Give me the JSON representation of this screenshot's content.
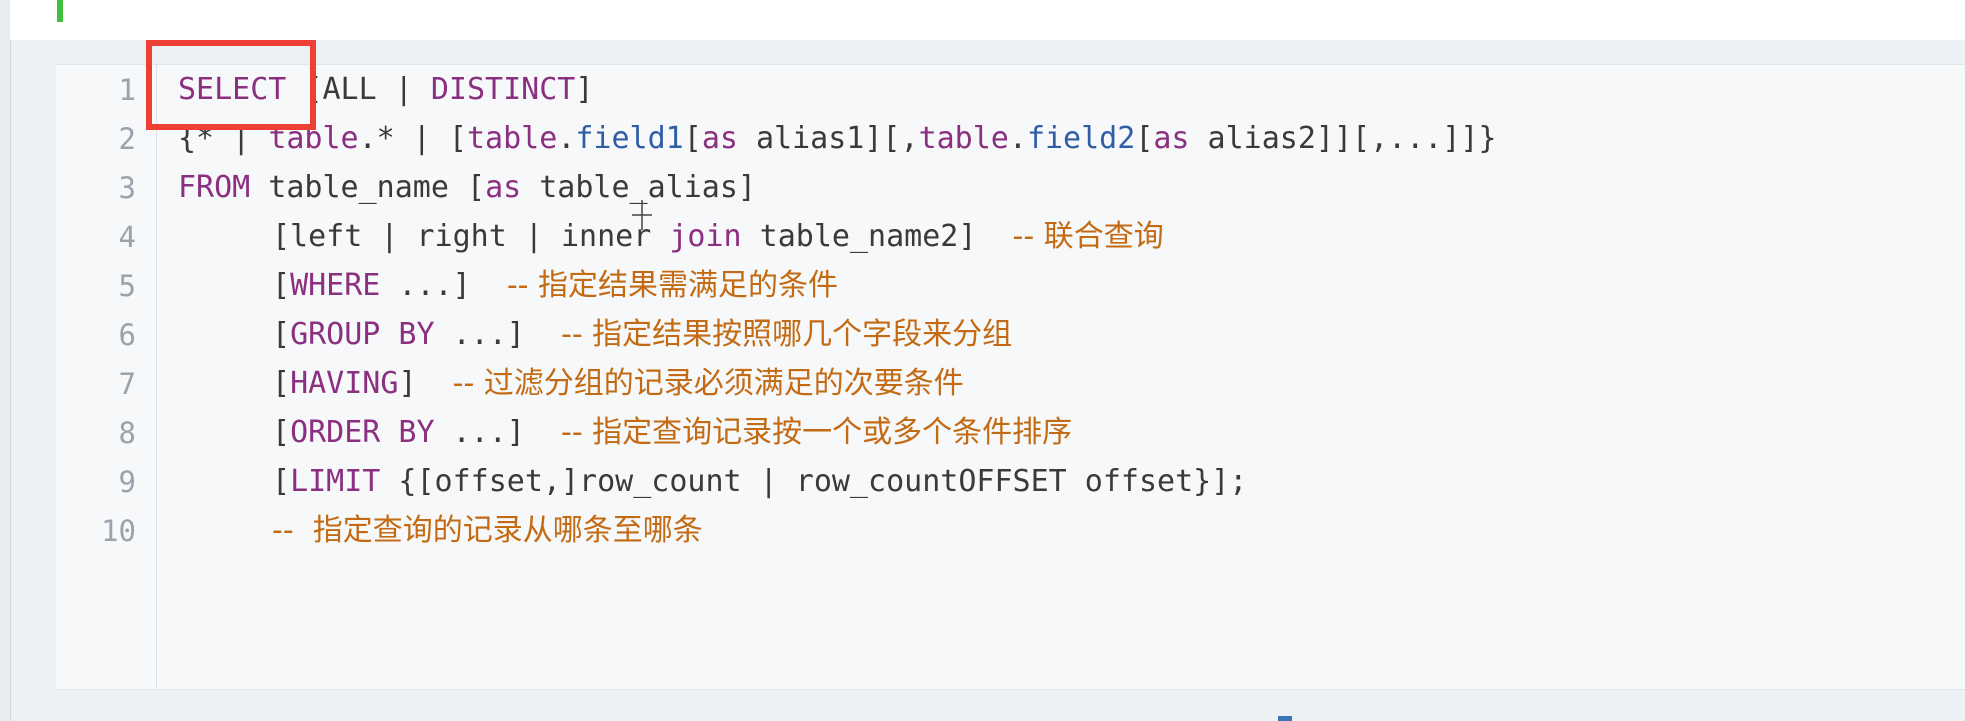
{
  "code": {
    "lines": [
      {
        "number": "1",
        "parts": [
          "SELECT",
          " [ALL | ",
          "DISTINCT",
          "]"
        ]
      },
      {
        "number": "2",
        "parts": [
          "{* | ",
          "table",
          ".* | [",
          "table",
          ".",
          "field1",
          "[",
          "as",
          " alias1][,",
          "table",
          ".",
          "field2",
          "[",
          "as",
          " alias2]][,...]]}"
        ]
      },
      {
        "number": "3",
        "parts": [
          "FROM",
          " table_name [",
          "as",
          " table_alias]"
        ]
      },
      {
        "number": "4",
        "parts": [
          "[left | right | inner ",
          "join",
          " table_name2]  ",
          "-- 联合查询"
        ]
      },
      {
        "number": "5",
        "parts": [
          "[",
          "WHERE",
          " ...]  ",
          "-- 指定结果需满足的条件"
        ]
      },
      {
        "number": "6",
        "parts": [
          "[",
          "GROUP BY",
          " ...]  ",
          "-- 指定结果按照哪几个字段来分组"
        ]
      },
      {
        "number": "7",
        "parts": [
          "[",
          "HAVING",
          "]  ",
          "-- 过滤分组的记录必须满足的次要条件"
        ]
      },
      {
        "number": "8",
        "parts": [
          "[",
          "ORDER BY",
          " ...]  ",
          "-- 指定查询记录按一个或多个条件排序"
        ]
      },
      {
        "number": "9",
        "parts": [
          "[",
          "LIMIT",
          " {[offset,]row_count | row_countOFFSET offset}];"
        ]
      },
      {
        "number": "10",
        "parts": [
          "--  指定查询的记录从哪条至哪条"
        ]
      }
    ]
  },
  "colors": {
    "keyword": "#8b2f80",
    "identifier": "#2f5ea5",
    "comment": "#c36a12",
    "highlight_box": "#ee3f34",
    "cursor_bar": "#3fbf3a"
  },
  "icons": {
    "cursor": "crosshair-cursor-icon"
  }
}
